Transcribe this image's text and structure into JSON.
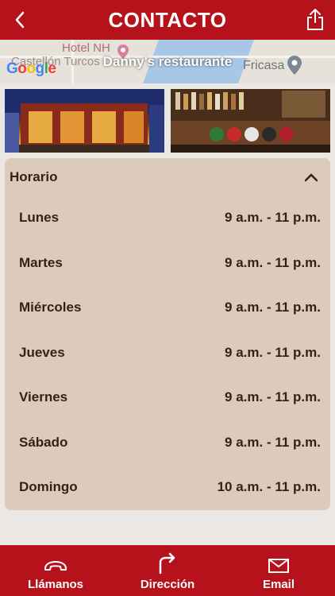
{
  "header": {
    "title": "CONTACTO"
  },
  "map": {
    "hotel_label": "Hotel NH",
    "castellon_label": "Castellón Turcos",
    "restaurant_label": "Danny's restaurante",
    "fricasa_label": "Fricasa",
    "google_logo": {
      "g1": "G",
      "o1": "o",
      "o2": "o",
      "g2": "g",
      "l": "l",
      "e": "e"
    }
  },
  "schedule": {
    "title": "Horario",
    "days": [
      {
        "day": "Lunes",
        "hours": "9 a.m. - 11 p.m."
      },
      {
        "day": "Martes",
        "hours": "9 a.m. - 11 p.m."
      },
      {
        "day": "Miércoles",
        "hours": "9 a.m. - 11 p.m."
      },
      {
        "day": "Jueves",
        "hours": "9 a.m. - 11 p.m."
      },
      {
        "day": "Viernes",
        "hours": "9 a.m. - 11 p.m."
      },
      {
        "day": "Sábado",
        "hours": "9 a.m. - 11 p.m."
      },
      {
        "day": "Domingo",
        "hours": "10 a.m. - 11 p.m."
      }
    ]
  },
  "tabbar": {
    "call_label": "Llámanos",
    "directions_label": "Dirección",
    "email_label": "Email"
  },
  "colors": {
    "brand": "#b5121b",
    "card": "#dccbbb",
    "text": "#3a1f0e",
    "background": "#ebe7e4"
  }
}
